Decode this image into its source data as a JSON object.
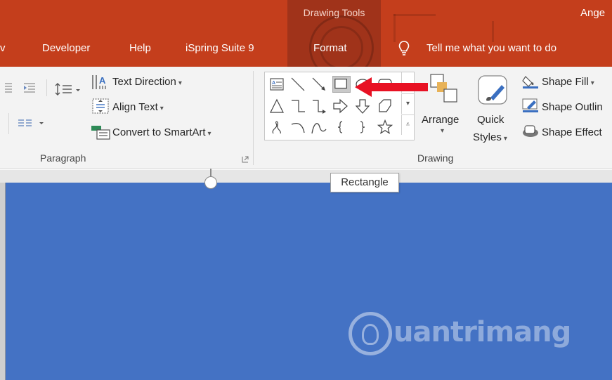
{
  "titlebar": {
    "contextual_label": "Drawing Tools",
    "user_name": "Ange",
    "colors": {
      "background": "#c43e1c",
      "contextual_band": "#a0331a"
    }
  },
  "tabs": [
    {
      "label": "v"
    },
    {
      "label": "Developer"
    },
    {
      "label": "Help"
    },
    {
      "label": "iSpring Suite 9"
    },
    {
      "label": "Format",
      "active": true
    }
  ],
  "tell_me": {
    "icon": "lightbulb-icon",
    "label": "Tell me what you want to do"
  },
  "paragraph_group": {
    "label": "Paragraph",
    "text_direction": "Text Direction",
    "align_text": "Align Text",
    "convert_smartart": "Convert to SmartArt"
  },
  "drawing_group": {
    "label": "Drawing",
    "arrange": "Arrange",
    "quick_styles_line1": "Quick",
    "quick_styles_line2": "Styles",
    "shape_fill": "Shape Fill",
    "shape_outline": "Shape Outlin",
    "shape_effects": "Shape Effect",
    "shapes": [
      "text-box-icon",
      "line-icon",
      "arrow-line-icon",
      "rectangle-icon",
      "oval-icon",
      "rounded-rectangle-icon",
      "triangle-icon",
      "elbow-connector-icon",
      "elbow-arrow-connector-icon",
      "right-arrow-icon",
      "down-arrow-icon",
      "pentagon-shape-icon",
      "freeform-icon",
      "arc-icon",
      "curve-icon",
      "left-brace-icon",
      "right-brace-icon",
      "star-icon"
    ]
  },
  "tooltip": {
    "text": "Rectangle"
  },
  "slide": {
    "background": "#4472c4"
  },
  "watermark": {
    "text": "uantrimang"
  }
}
